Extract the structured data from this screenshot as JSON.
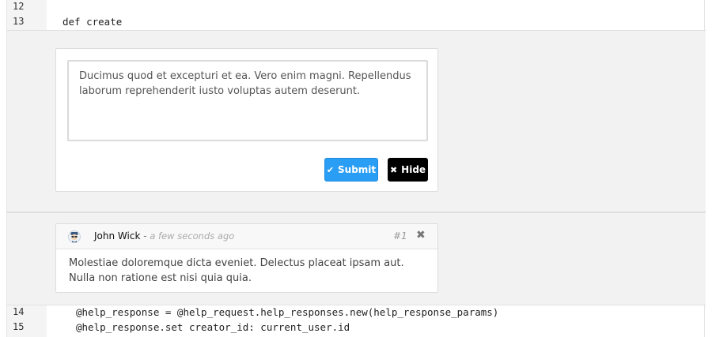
{
  "code_top": [
    {
      "line": "12",
      "tokens": []
    },
    {
      "line": "13",
      "tokens": [
        {
          "t": "def create",
          "c": "kw"
        }
      ]
    }
  ],
  "reply_form": {
    "text": "Ducimus quod et excepturi et ea. Vero enim magni. Repellendus laborum reprehenderit iusto voluptas autem deserunt.",
    "submit_label": "Submit",
    "submit_icon": "check-icon",
    "hide_label": "Hide",
    "hide_icon": "x-icon",
    "colors": {
      "submit": "#2a9df4",
      "hide": "#000000"
    }
  },
  "comment": {
    "author": "John Wick",
    "separator": " - ",
    "time": "a few seconds ago",
    "number": "#1",
    "close_icon": "close-icon",
    "body": "Molestiae doloremque dicta eveniet. Delectus placeat ipsam aut. Nulla non ratione est nisi quia quia."
  },
  "code_bottom": [
    {
      "line": "14",
      "text": "@help_response = @help_request.help_responses.new(help_response_params)"
    },
    {
      "line": "15",
      "text": "@help_response.set creator_id: current_user.id"
    }
  ]
}
